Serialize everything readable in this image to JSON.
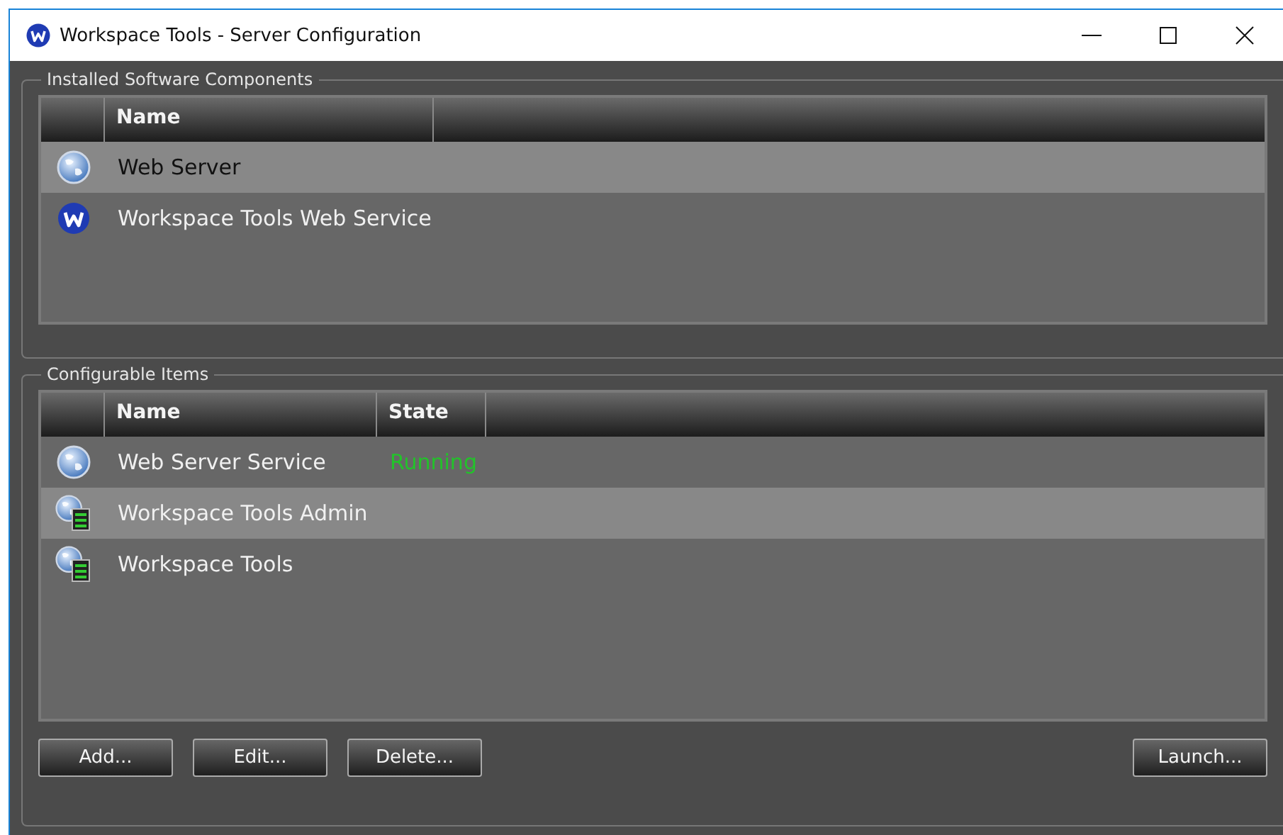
{
  "window": {
    "title": "Workspace Tools - Server Configuration"
  },
  "groups": [
    {
      "title": "Installed Software Components",
      "focused": true,
      "columns": [
        {
          "label": "Name"
        }
      ],
      "rows": [
        {
          "kind": "globe",
          "cells": [
            "Web Server"
          ],
          "selected": true
        },
        {
          "kind": "logo",
          "cells": [
            "Workspace Tools Web Service"
          ],
          "selected": false
        }
      ]
    },
    {
      "title": "Configurable Items",
      "focused": false,
      "columns": [
        {
          "label": "Name"
        },
        {
          "label": "State"
        }
      ],
      "rows": [
        {
          "kind": "globe",
          "cells": [
            "Web Server Service",
            "Running"
          ],
          "selected": false
        },
        {
          "kind": "globe-server",
          "cells": [
            "Workspace Tools Admin"
          ],
          "selected": true
        },
        {
          "kind": "globe-server",
          "cells": [
            "Workspace Tools"
          ],
          "selected": false
        }
      ],
      "buttons": [
        {
          "label": "Add..."
        },
        {
          "label": "Edit..."
        },
        {
          "label": "Delete..."
        },
        {
          "label": "Launch..."
        }
      ]
    }
  ]
}
